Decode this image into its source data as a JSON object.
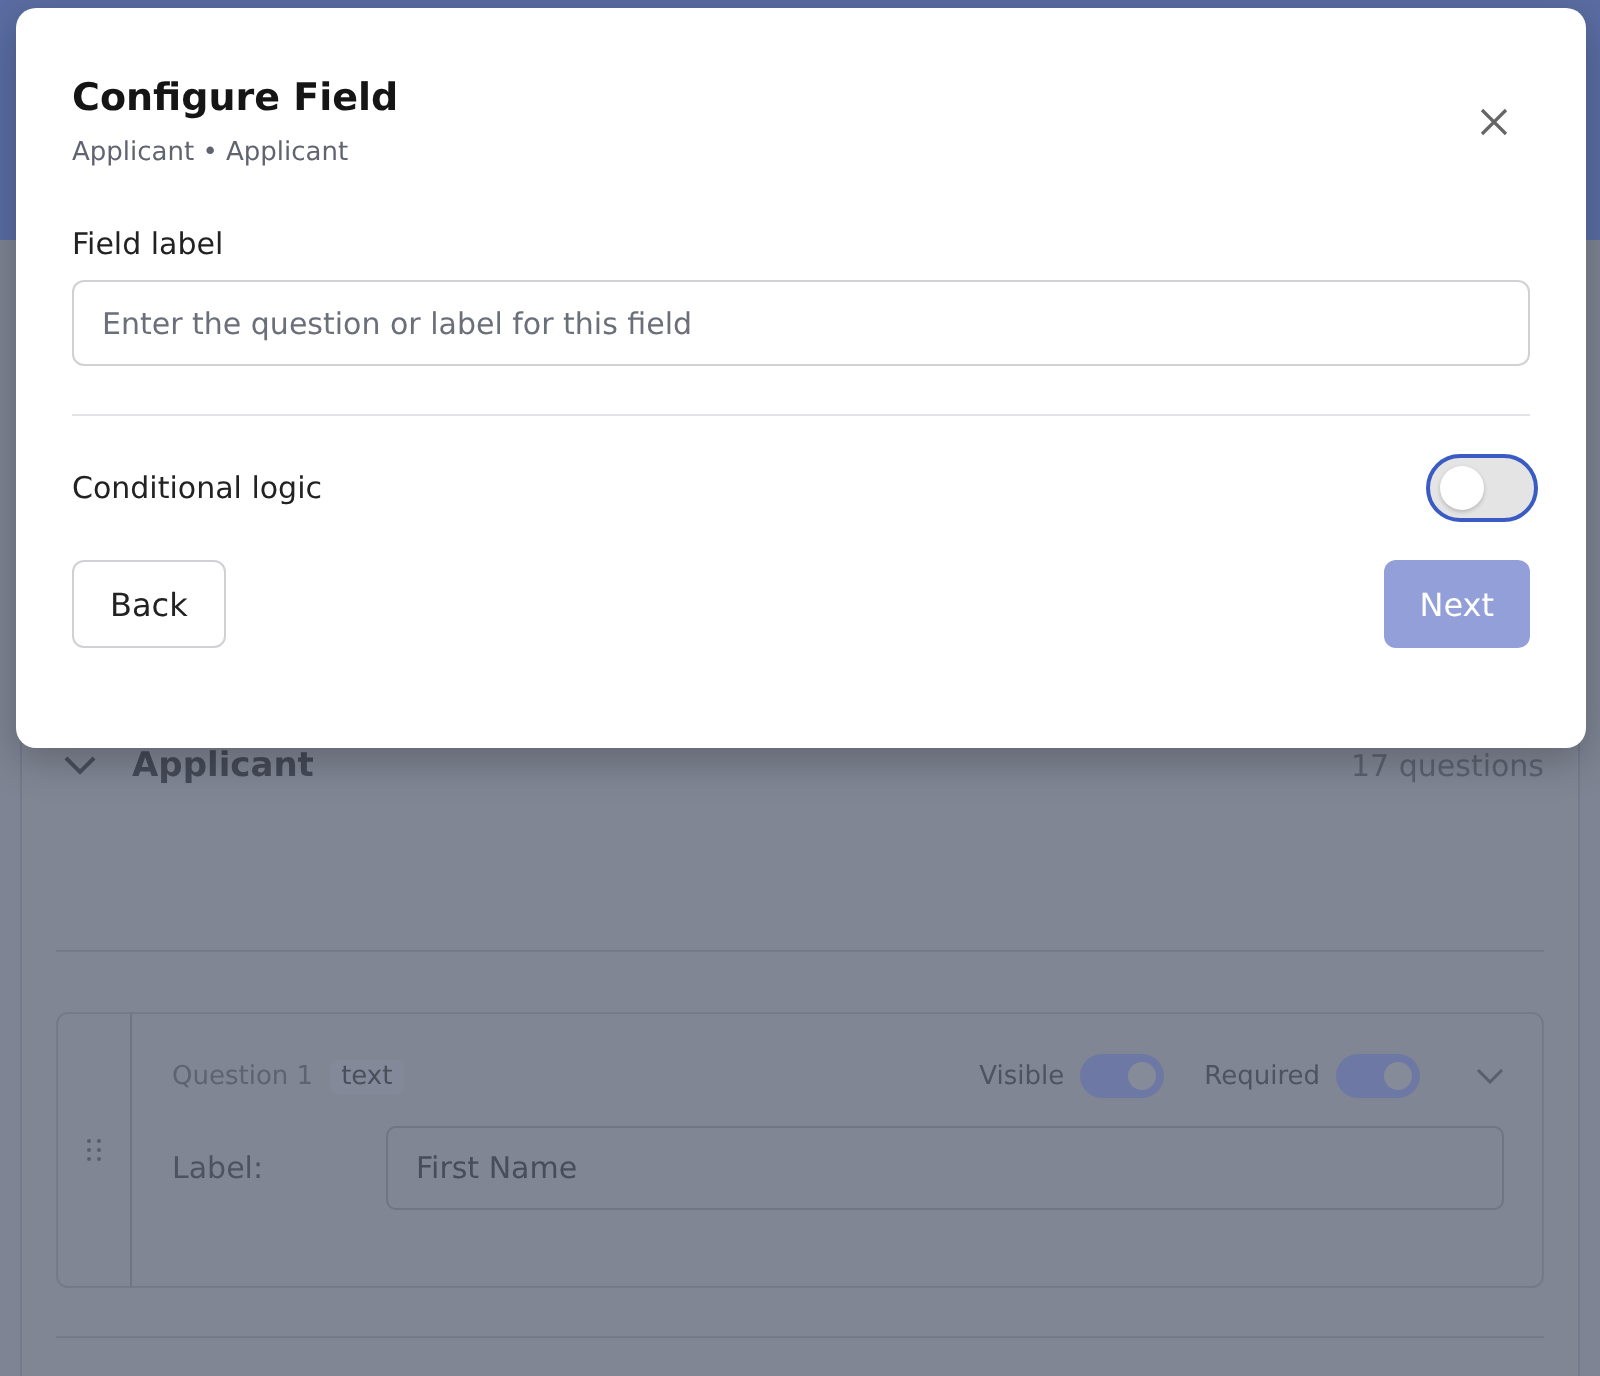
{
  "dialog": {
    "title": "Configure Field",
    "subtitle": "Applicant • Applicant",
    "field": {
      "label": "Field label",
      "placeholder": "Enter the question or label for this field"
    },
    "conditional_logic": {
      "label": "Conditional logic",
      "on": false
    },
    "buttons": [
      {
        "label": "Back",
        "kind": "secondary",
        "disabled": false
      },
      {
        "label": "Next",
        "kind": "primary",
        "disabled": true
      }
    ]
  },
  "section": {
    "title": "Applicant",
    "count": "17 questions",
    "expanded": true,
    "questions": [
      {
        "number": "Question 1",
        "type": "text",
        "visible_label": "Visible",
        "visible": true,
        "required_label": "Required",
        "required": true,
        "expanded": false,
        "caption": "Label:",
        "value": "First Name"
      }
    ]
  }
}
